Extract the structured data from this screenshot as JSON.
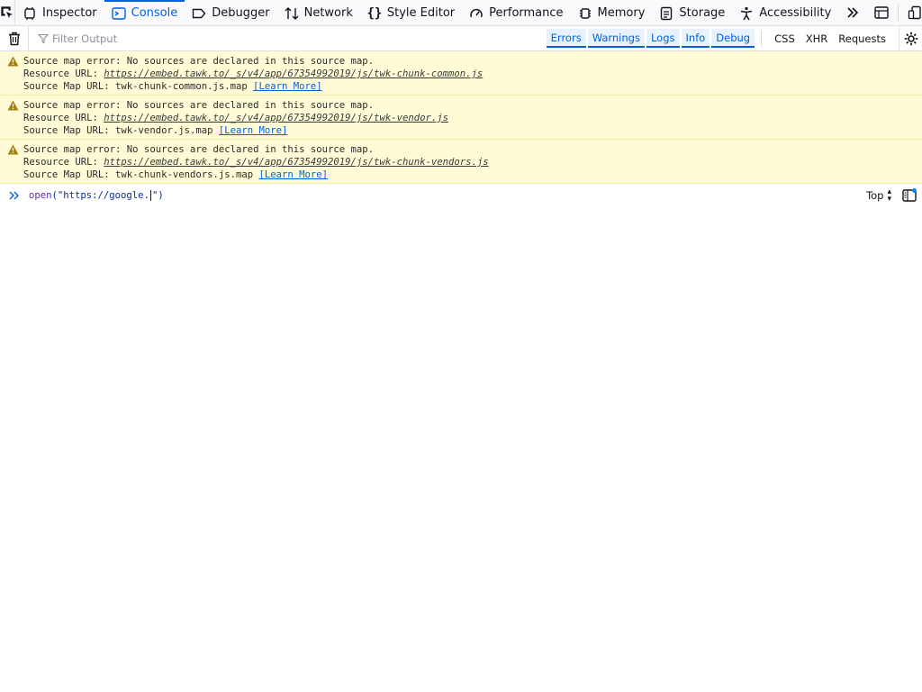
{
  "toolbar": {
    "tabs": [
      {
        "label": "Inspector",
        "icon": "inspector-icon"
      },
      {
        "label": "Console",
        "icon": "console-icon",
        "selected": true
      },
      {
        "label": "Debugger",
        "icon": "debugger-icon"
      },
      {
        "label": "Network",
        "icon": "network-icon"
      },
      {
        "label": "Style Editor",
        "icon": "style-editor-icon"
      },
      {
        "label": "Performance",
        "icon": "performance-icon"
      },
      {
        "label": "Memory",
        "icon": "memory-icon"
      },
      {
        "label": "Storage",
        "icon": "storage-icon"
      },
      {
        "label": "Accessibility",
        "icon": "accessibility-icon"
      }
    ]
  },
  "filterbar": {
    "placeholder": "Filter Output",
    "levels": [
      "Errors",
      "Warnings",
      "Logs",
      "Info",
      "Debug"
    ],
    "network": [
      "CSS",
      "XHR",
      "Requests"
    ]
  },
  "messages": [
    {
      "level": "warning",
      "text": "Source map error: No sources are declared in this source map.",
      "resource_label": "Resource URL: ",
      "resource_url": "https://embed.tawk.to/_s/v4/app/67354992019/js/twk-chunk-common.js",
      "map_label": "Source Map URL: twk-chunk-common.js.map ",
      "learn_more": "[Learn More]"
    },
    {
      "level": "warning",
      "text": "Source map error: No sources are declared in this source map.",
      "resource_label": "Resource URL: ",
      "resource_url": "https://embed.tawk.to/_s/v4/app/67354992019/js/twk-vendor.js",
      "map_label": "Source Map URL: twk-vendor.js.map ",
      "learn_more": "[Learn More]"
    },
    {
      "level": "warning",
      "text": "Source map error: No sources are declared in this source map.",
      "resource_label": "Resource URL: ",
      "resource_url": "https://embed.tawk.to/_s/v4/app/67354992019/js/twk-chunk-vendors.js",
      "map_label": "Source Map URL: twk-chunk-vendors.js.map ",
      "learn_more": "[Learn More]"
    }
  ],
  "input": {
    "fn": "open",
    "before_caret": "(\"https://google.",
    "after_caret": "\")",
    "context": "Top"
  },
  "colors": {
    "accent": "#0061e0",
    "warning_bg": "#fffbd6",
    "warning_icon": "#a4800a"
  }
}
